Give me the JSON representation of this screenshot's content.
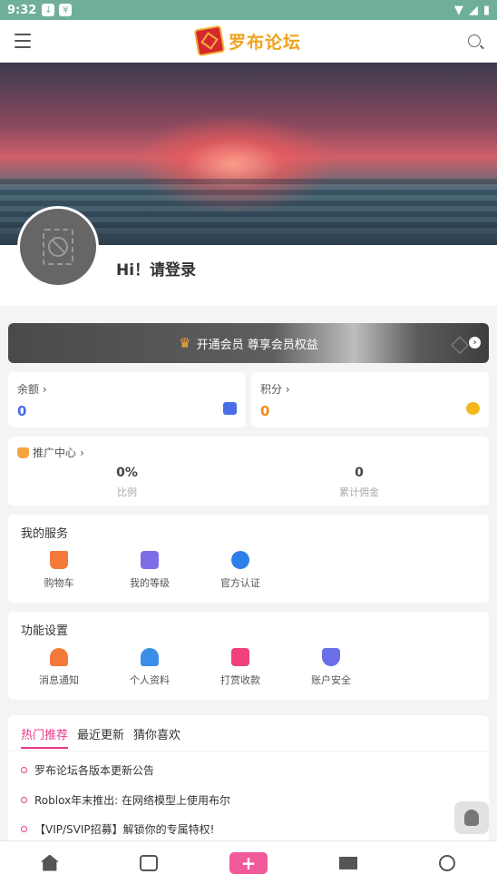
{
  "status": {
    "time": "9:32"
  },
  "header": {
    "logo_text": "罗布论坛"
  },
  "profile": {
    "greeting": "Hi！请登录"
  },
  "vip": {
    "label": "开通会员 尊享会员权益"
  },
  "balance": {
    "label": "余额",
    "value": "0"
  },
  "points": {
    "label": "积分",
    "value": "0"
  },
  "promotion": {
    "title": "推广中心",
    "ratio_value": "0%",
    "ratio_label": "比例",
    "commission_value": "0",
    "commission_label": "累计佣金"
  },
  "services": {
    "title": "我的服务",
    "items": [
      {
        "label": "购物车",
        "icon": "cart-icon",
        "color": "#f27a3a"
      },
      {
        "label": "我的等级",
        "icon": "level-icon",
        "color": "#7b6ee8"
      },
      {
        "label": "官方认证",
        "icon": "verified-icon",
        "color": "#2e7ee8"
      }
    ]
  },
  "settings": {
    "title": "功能设置",
    "items": [
      {
        "label": "消息通知",
        "icon": "bell-icon",
        "color": "#f27a3a"
      },
      {
        "label": "个人资料",
        "icon": "profile-icon",
        "color": "#3a8ee8"
      },
      {
        "label": "打赏收款",
        "icon": "gift-icon",
        "color": "#f0417a"
      },
      {
        "label": "账户安全",
        "icon": "shield-icon",
        "color": "#6a6ee8"
      }
    ]
  },
  "feed": {
    "tabs": [
      "热门推荐",
      "最近更新",
      "猜你喜欢"
    ],
    "posts": [
      "罗布论坛各版本更新公告",
      "Roblox年末推出: 在网络模型上使用布尔",
      "【VIP/SVIP招募】解锁你的专属特权!"
    ]
  },
  "colors": {
    "accent": "#e8388a",
    "balance": "#4a6ee8",
    "points": "#f28a1c"
  }
}
